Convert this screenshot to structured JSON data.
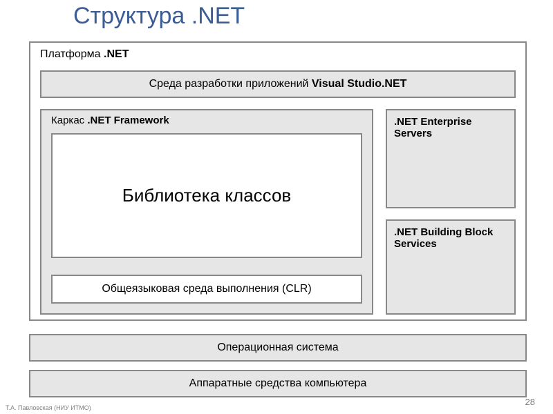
{
  "title": "Структура .NET",
  "platform": {
    "label_prefix": "Платформа ",
    "label_bold": ".NET",
    "ide_prefix": "Среда разработки приложений ",
    "ide_bold": "Visual Studio.NET",
    "framework": {
      "label_prefix": "Каркас ",
      "label_bold": ".NET Framework",
      "classlib": "Библиотека классов",
      "clr": "Общеязыковая среда выполнения (CLR)"
    },
    "enterprise": ".NET Enterprise Servers",
    "building": ".NET Building Block Services"
  },
  "os": "Операционная система",
  "hardware": "Аппаратные средства компьютера",
  "page_number": "28",
  "footer": "Т.А. Павловская (НИУ ИТМО)"
}
